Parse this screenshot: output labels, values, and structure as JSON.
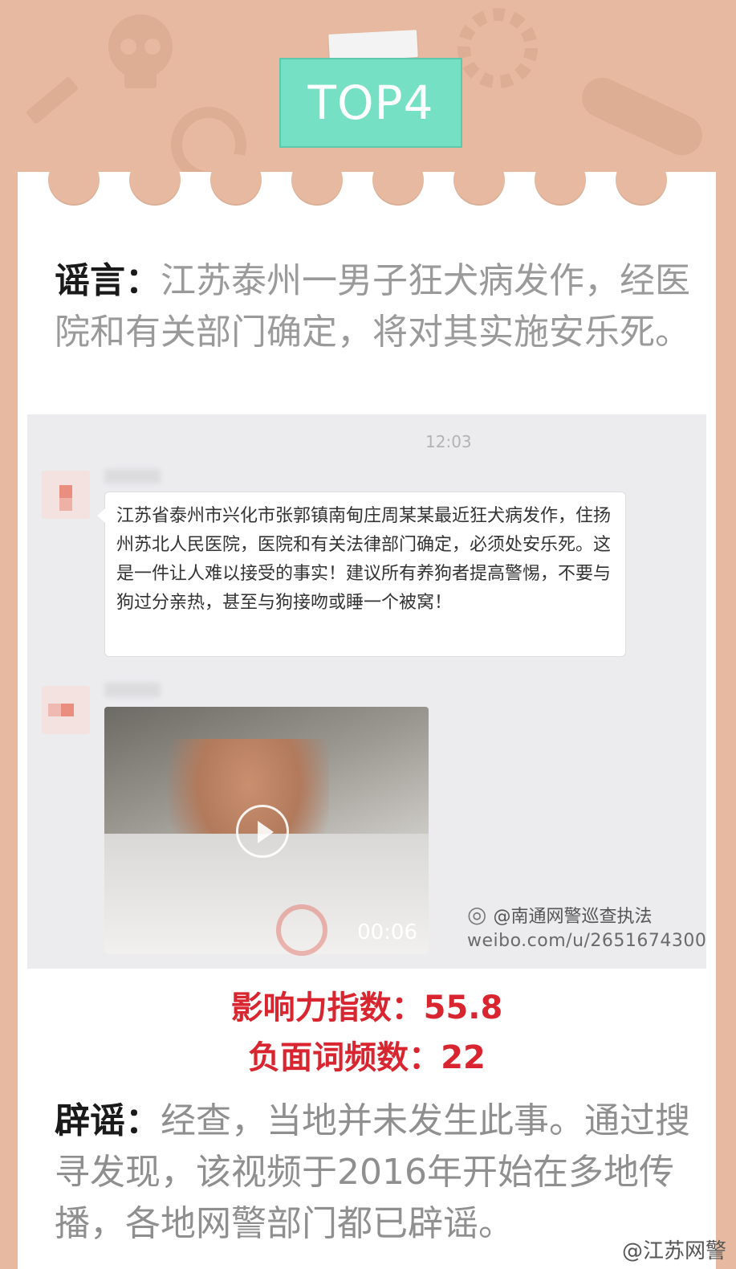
{
  "badge": {
    "label": "TOP4"
  },
  "rumor": {
    "label": "谣言：",
    "text": "江苏泰州一男子狂犬病发作，经医院和有关部门确定，将对其实施安乐死。"
  },
  "chat": {
    "time": "12:03",
    "message": "江苏省泰州市兴化市张郭镇南甸庄周某某最近狂犬病发作，住扬州苏北人民医院，医院和有关法律部门确定，必须处安乐死。这是一件让人难以接受的事实！建议所有养狗者提高警惕，不要与狗过分亲热，甚至与狗接吻或睡一个被窝！",
    "video_duration": "00:06",
    "weibo_handle": "@南通网警巡查执法",
    "weibo_url": "weibo.com/u/2651674300"
  },
  "stats": {
    "influence_label": "影响力指数：",
    "influence_value": "55.8",
    "negative_label": "负面词频数：",
    "negative_value": "22"
  },
  "debunk": {
    "label": "辟谣：",
    "text": "经查，当地并未发生此事。通过搜寻发现，该视频于2016年开始在多地传播，各地网警部门都已辟谣。"
  },
  "credit": "@江苏网警",
  "colors": {
    "background": "#e6b9a0",
    "badge": "#76e0c4",
    "stats_red": "#d8252f"
  }
}
